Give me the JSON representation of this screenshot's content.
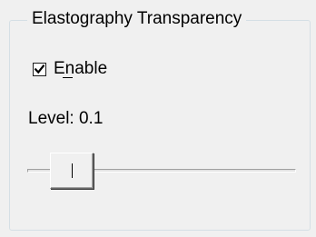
{
  "group": {
    "title": "Elastography Transparency"
  },
  "enable_checkbox": {
    "label": "Enable",
    "mnemonic": "E",
    "checked": true,
    "icon": "checkmark-icon"
  },
  "level": {
    "label": "Level: 0.1"
  },
  "slider": {
    "value": 0.1,
    "min": 0,
    "max": 1
  }
}
